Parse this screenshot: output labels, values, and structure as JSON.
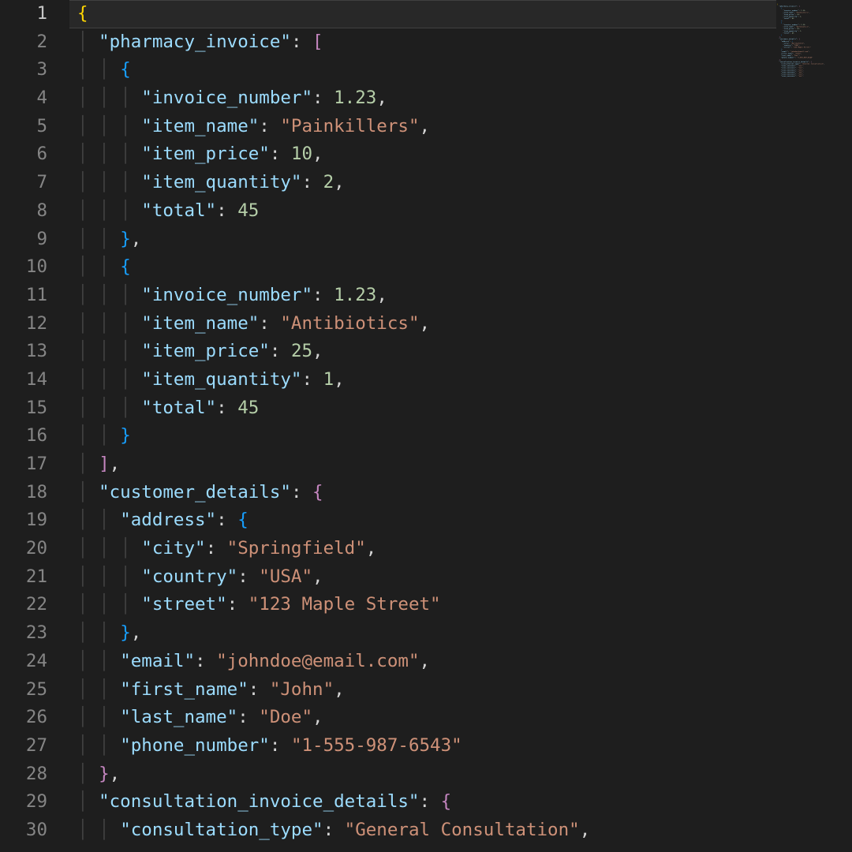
{
  "editor": {
    "active_line": 1,
    "lines": [
      {
        "n": 1,
        "indent": 0,
        "tokens": [
          {
            "t": "brace",
            "v": "{"
          }
        ]
      },
      {
        "n": 2,
        "indent": 1,
        "tokens": [
          {
            "t": "key",
            "v": "\"pharmacy_invoice\""
          },
          {
            "t": "colon",
            "v": ": "
          },
          {
            "t": "brace2",
            "v": "["
          }
        ]
      },
      {
        "n": 3,
        "indent": 2,
        "tokens": [
          {
            "t": "brace3",
            "v": "{"
          }
        ]
      },
      {
        "n": 4,
        "indent": 3,
        "tokens": [
          {
            "t": "key",
            "v": "\"invoice_number\""
          },
          {
            "t": "colon",
            "v": ": "
          },
          {
            "t": "num",
            "v": "1.23"
          },
          {
            "t": "punc",
            "v": ","
          }
        ]
      },
      {
        "n": 5,
        "indent": 3,
        "tokens": [
          {
            "t": "key",
            "v": "\"item_name\""
          },
          {
            "t": "colon",
            "v": ": "
          },
          {
            "t": "str",
            "v": "\"Painkillers\""
          },
          {
            "t": "punc",
            "v": ","
          }
        ]
      },
      {
        "n": 6,
        "indent": 3,
        "tokens": [
          {
            "t": "key",
            "v": "\"item_price\""
          },
          {
            "t": "colon",
            "v": ": "
          },
          {
            "t": "num",
            "v": "10"
          },
          {
            "t": "punc",
            "v": ","
          }
        ]
      },
      {
        "n": 7,
        "indent": 3,
        "tokens": [
          {
            "t": "key",
            "v": "\"item_quantity\""
          },
          {
            "t": "colon",
            "v": ": "
          },
          {
            "t": "num",
            "v": "2"
          },
          {
            "t": "punc",
            "v": ","
          }
        ]
      },
      {
        "n": 8,
        "indent": 3,
        "tokens": [
          {
            "t": "key",
            "v": "\"total\""
          },
          {
            "t": "colon",
            "v": ": "
          },
          {
            "t": "num",
            "v": "45"
          }
        ]
      },
      {
        "n": 9,
        "indent": 2,
        "tokens": [
          {
            "t": "brace3",
            "v": "}"
          },
          {
            "t": "punc",
            "v": ","
          }
        ]
      },
      {
        "n": 10,
        "indent": 2,
        "tokens": [
          {
            "t": "brace3",
            "v": "{"
          }
        ]
      },
      {
        "n": 11,
        "indent": 3,
        "tokens": [
          {
            "t": "key",
            "v": "\"invoice_number\""
          },
          {
            "t": "colon",
            "v": ": "
          },
          {
            "t": "num",
            "v": "1.23"
          },
          {
            "t": "punc",
            "v": ","
          }
        ]
      },
      {
        "n": 12,
        "indent": 3,
        "tokens": [
          {
            "t": "key",
            "v": "\"item_name\""
          },
          {
            "t": "colon",
            "v": ": "
          },
          {
            "t": "str",
            "v": "\"Antibiotics\""
          },
          {
            "t": "punc",
            "v": ","
          }
        ]
      },
      {
        "n": 13,
        "indent": 3,
        "tokens": [
          {
            "t": "key",
            "v": "\"item_price\""
          },
          {
            "t": "colon",
            "v": ": "
          },
          {
            "t": "num",
            "v": "25"
          },
          {
            "t": "punc",
            "v": ","
          }
        ]
      },
      {
        "n": 14,
        "indent": 3,
        "tokens": [
          {
            "t": "key",
            "v": "\"item_quantity\""
          },
          {
            "t": "colon",
            "v": ": "
          },
          {
            "t": "num",
            "v": "1"
          },
          {
            "t": "punc",
            "v": ","
          }
        ]
      },
      {
        "n": 15,
        "indent": 3,
        "tokens": [
          {
            "t": "key",
            "v": "\"total\""
          },
          {
            "t": "colon",
            "v": ": "
          },
          {
            "t": "num",
            "v": "45"
          }
        ]
      },
      {
        "n": 16,
        "indent": 2,
        "tokens": [
          {
            "t": "brace3",
            "v": "}"
          }
        ]
      },
      {
        "n": 17,
        "indent": 1,
        "tokens": [
          {
            "t": "brace2",
            "v": "]"
          },
          {
            "t": "punc",
            "v": ","
          }
        ]
      },
      {
        "n": 18,
        "indent": 1,
        "tokens": [
          {
            "t": "key",
            "v": "\"customer_details\""
          },
          {
            "t": "colon",
            "v": ": "
          },
          {
            "t": "brace2",
            "v": "{"
          }
        ]
      },
      {
        "n": 19,
        "indent": 2,
        "tokens": [
          {
            "t": "key",
            "v": "\"address\""
          },
          {
            "t": "colon",
            "v": ": "
          },
          {
            "t": "brace3",
            "v": "{"
          }
        ]
      },
      {
        "n": 20,
        "indent": 3,
        "tokens": [
          {
            "t": "key",
            "v": "\"city\""
          },
          {
            "t": "colon",
            "v": ": "
          },
          {
            "t": "str",
            "v": "\"Springfield\""
          },
          {
            "t": "punc",
            "v": ","
          }
        ]
      },
      {
        "n": 21,
        "indent": 3,
        "tokens": [
          {
            "t": "key",
            "v": "\"country\""
          },
          {
            "t": "colon",
            "v": ": "
          },
          {
            "t": "str",
            "v": "\"USA\""
          },
          {
            "t": "punc",
            "v": ","
          }
        ]
      },
      {
        "n": 22,
        "indent": 3,
        "tokens": [
          {
            "t": "key",
            "v": "\"street\""
          },
          {
            "t": "colon",
            "v": ": "
          },
          {
            "t": "str",
            "v": "\"123 Maple Street\""
          }
        ]
      },
      {
        "n": 23,
        "indent": 2,
        "tokens": [
          {
            "t": "brace3",
            "v": "}"
          },
          {
            "t": "punc",
            "v": ","
          }
        ]
      },
      {
        "n": 24,
        "indent": 2,
        "tokens": [
          {
            "t": "key",
            "v": "\"email\""
          },
          {
            "t": "colon",
            "v": ": "
          },
          {
            "t": "str",
            "v": "\"johndoe@email.com\""
          },
          {
            "t": "punc",
            "v": ","
          }
        ]
      },
      {
        "n": 25,
        "indent": 2,
        "tokens": [
          {
            "t": "key",
            "v": "\"first_name\""
          },
          {
            "t": "colon",
            "v": ": "
          },
          {
            "t": "str",
            "v": "\"John\""
          },
          {
            "t": "punc",
            "v": ","
          }
        ]
      },
      {
        "n": 26,
        "indent": 2,
        "tokens": [
          {
            "t": "key",
            "v": "\"last_name\""
          },
          {
            "t": "colon",
            "v": ": "
          },
          {
            "t": "str",
            "v": "\"Doe\""
          },
          {
            "t": "punc",
            "v": ","
          }
        ]
      },
      {
        "n": 27,
        "indent": 2,
        "tokens": [
          {
            "t": "key",
            "v": "\"phone_number\""
          },
          {
            "t": "colon",
            "v": ": "
          },
          {
            "t": "str",
            "v": "\"1-555-987-6543\""
          }
        ]
      },
      {
        "n": 28,
        "indent": 1,
        "tokens": [
          {
            "t": "brace2",
            "v": "}"
          },
          {
            "t": "punc",
            "v": ","
          }
        ]
      },
      {
        "n": 29,
        "indent": 1,
        "tokens": [
          {
            "t": "key",
            "v": "\"consultation_invoice_details\""
          },
          {
            "t": "colon",
            "v": ": "
          },
          {
            "t": "brace2",
            "v": "{"
          }
        ]
      },
      {
        "n": 30,
        "indent": 2,
        "tokens": [
          {
            "t": "key",
            "v": "\"consultation_type\""
          },
          {
            "t": "colon",
            "v": ": "
          },
          {
            "t": "str",
            "v": "\"General Consultation\""
          },
          {
            "t": "punc",
            "v": ","
          }
        ]
      }
    ]
  }
}
